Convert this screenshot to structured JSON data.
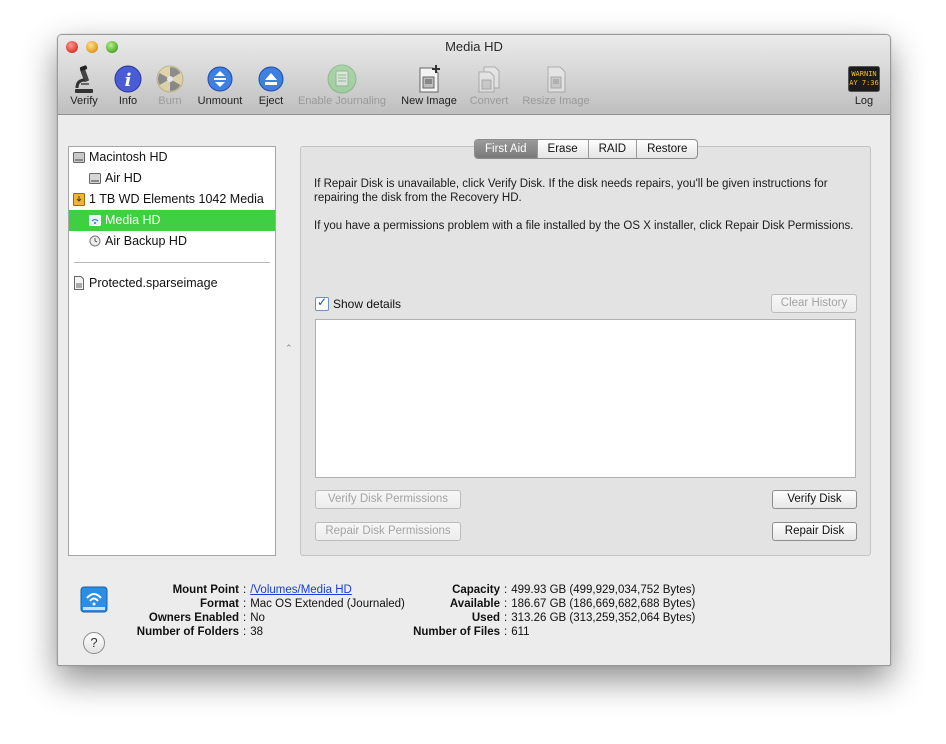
{
  "window": {
    "title": "Media HD"
  },
  "toolbar": {
    "verify": "Verify",
    "info": "Info",
    "burn": "Burn",
    "unmount": "Unmount",
    "eject": "Eject",
    "enable_journaling": "Enable Journaling",
    "new_image": "New Image",
    "convert": "Convert",
    "resize_image": "Resize Image",
    "log": "Log",
    "log_icon_line1": "WARNIN",
    "log_icon_line2": "AY 7:36"
  },
  "sidebar": {
    "items": [
      {
        "label": "Macintosh HD"
      },
      {
        "label": "Air HD"
      },
      {
        "label": "1 TB WD Elements 1042 Media"
      },
      {
        "label": "Media HD"
      },
      {
        "label": "Air Backup HD"
      },
      {
        "label": "Protected.sparseimage"
      }
    ],
    "selected": "Media HD"
  },
  "tabs": {
    "first_aid": "First Aid",
    "erase": "Erase",
    "raid": "RAID",
    "restore": "Restore",
    "active": "First Aid"
  },
  "first_aid": {
    "para1": "If Repair Disk is unavailable, click Verify Disk. If the disk needs repairs, you'll be given instructions for repairing the disk from the Recovery HD.",
    "para2": "If you have a permissions problem with a file installed by the OS X installer, click Repair Disk Permissions.",
    "show_details": "Show details",
    "show_details_checked": true,
    "clear_history": "Clear History",
    "verify_permissions": "Verify Disk Permissions",
    "verify_disk": "Verify Disk",
    "repair_permissions": "Repair Disk Permissions",
    "repair_disk": "Repair Disk"
  },
  "info": {
    "mount_point_label": "Mount Point",
    "mount_point": "/Volumes/Media HD",
    "format_label": "Format",
    "format": "Mac OS Extended (Journaled)",
    "owners_label": "Owners Enabled",
    "owners": "No",
    "folders_label": "Number of Folders",
    "folders": "38",
    "capacity_label": "Capacity",
    "capacity": "499.93 GB (499,929,034,752 Bytes)",
    "available_label": "Available",
    "available": "186.67 GB (186,669,682,688 Bytes)",
    "used_label": "Used",
    "used": "313.26 GB (313,259,352,064 Bytes)",
    "files_label": "Number of Files",
    "files": "611",
    "separator": ":",
    "help": "?"
  }
}
